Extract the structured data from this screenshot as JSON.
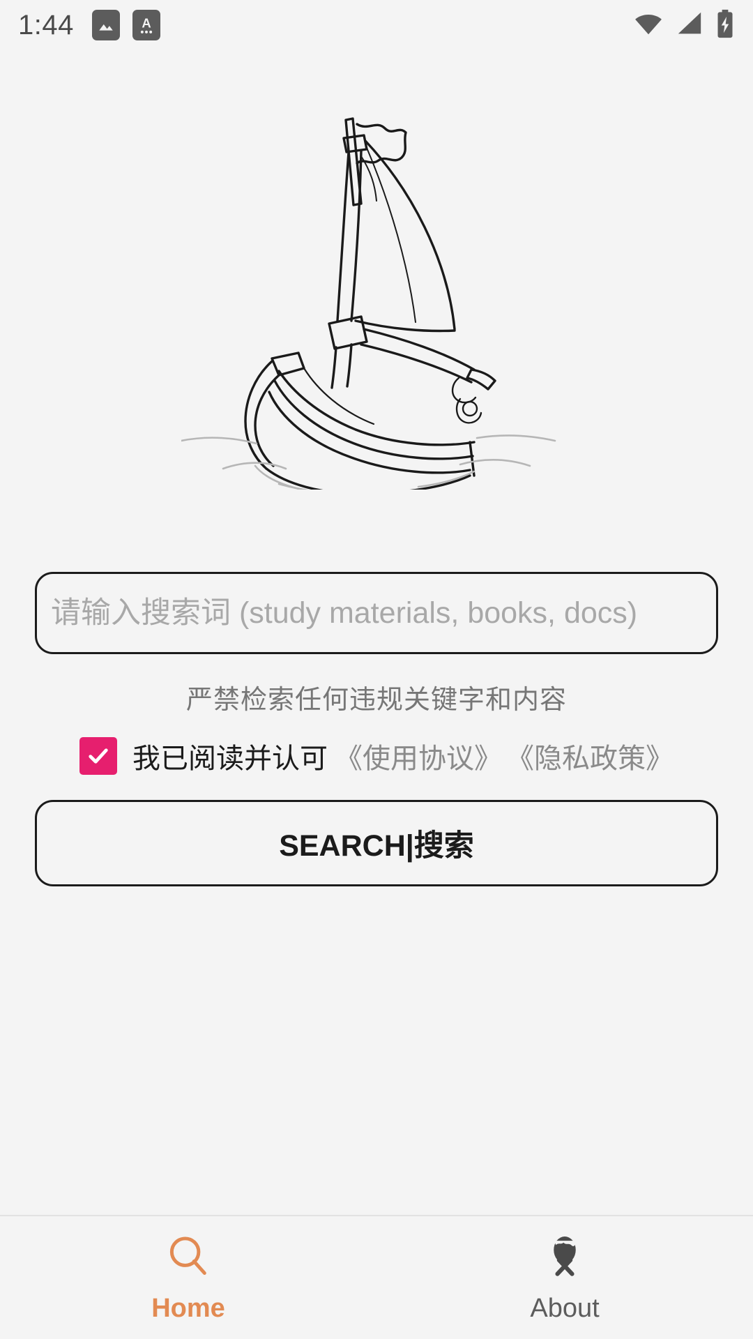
{
  "status_bar": {
    "time": "1:44",
    "left_icons": [
      {
        "name": "image-icon"
      },
      {
        "name": "text-input-icon"
      }
    ],
    "right_icons": [
      {
        "name": "wifi-icon"
      },
      {
        "name": "cellular-signal-icon"
      },
      {
        "name": "battery-charging-icon"
      }
    ]
  },
  "hero": {
    "illustration_name": "sailboat-illustration"
  },
  "search": {
    "placeholder": "请输入搜索词 (study materials, books, docs)",
    "value": "",
    "warning": "严禁检索任何违规关键字和内容",
    "button_label": "SEARCH|搜索"
  },
  "agreement": {
    "checked": true,
    "checkbox_color": "#e61f6e",
    "prefix": "我已阅读并认可",
    "links": [
      "《使用协议》",
      "《隐私政策》"
    ]
  },
  "bottom_nav": {
    "active_color": "#e28a52",
    "inactive_color": "#5c5c5c",
    "items": [
      {
        "label": "Home",
        "icon": "search-icon",
        "active": true
      },
      {
        "label": "About",
        "icon": "info-person-icon",
        "active": false
      }
    ]
  }
}
